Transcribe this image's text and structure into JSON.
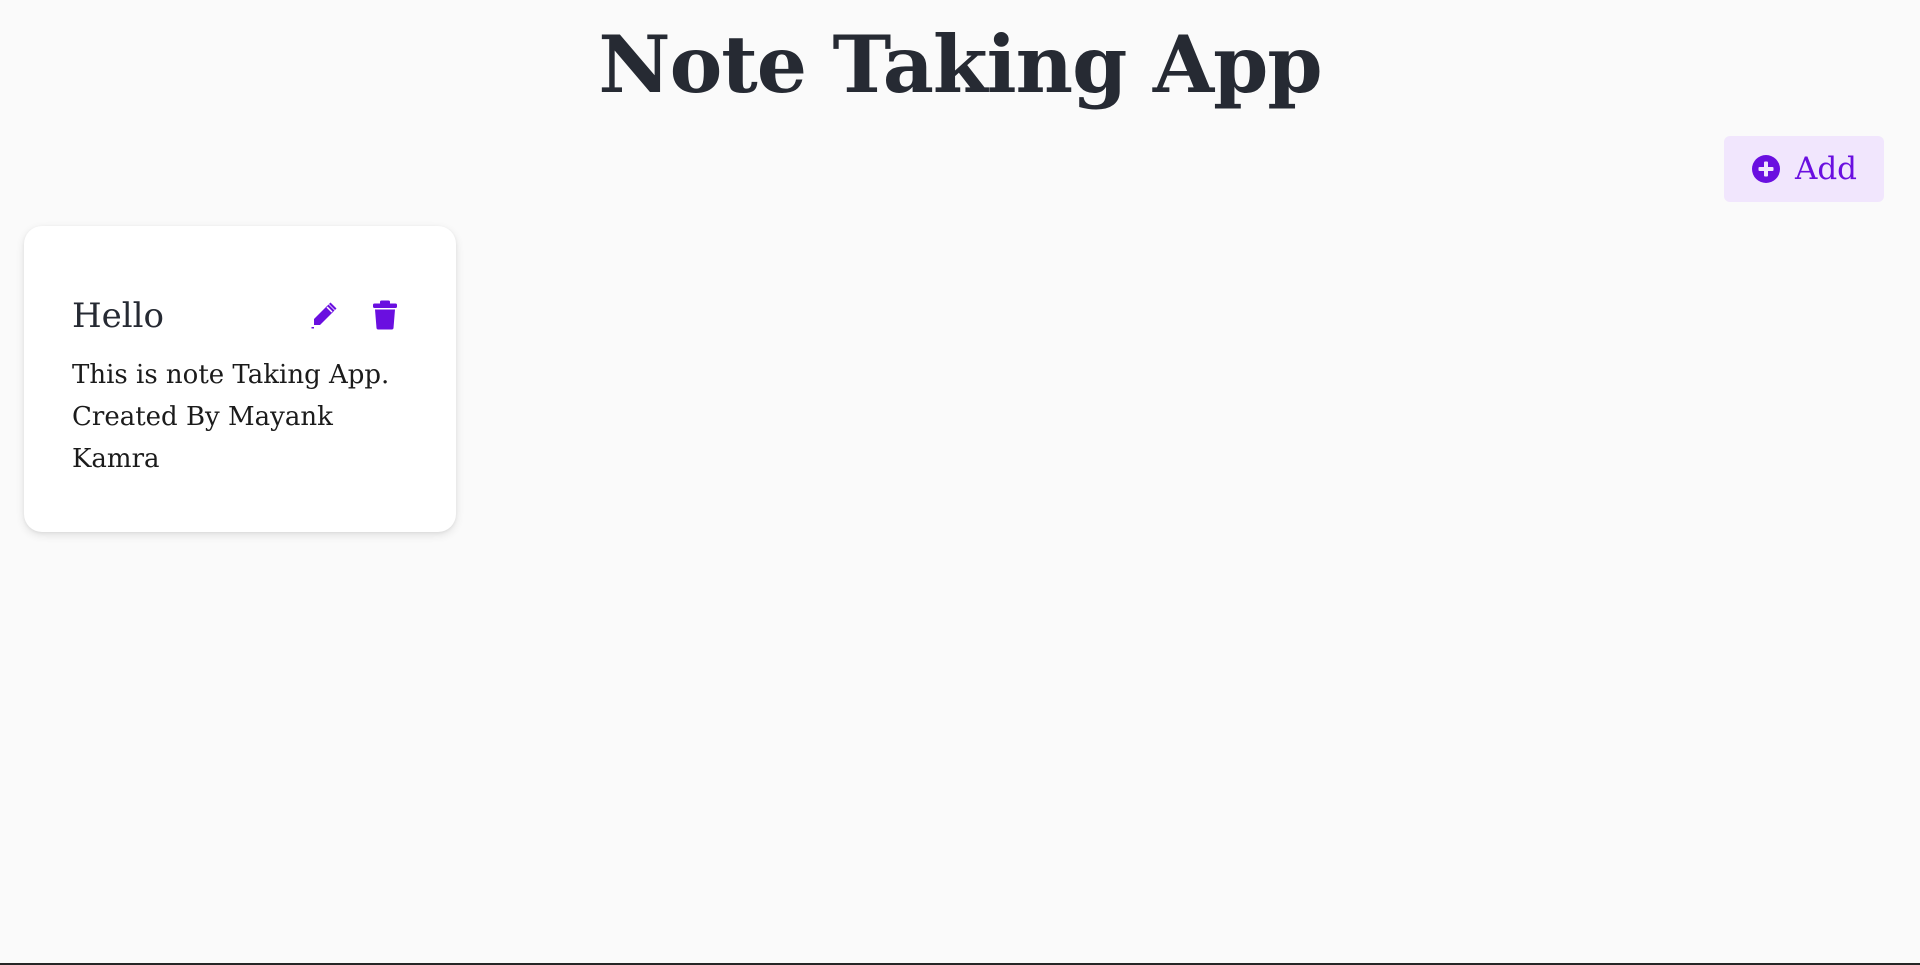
{
  "header": {
    "title": "Note Taking App"
  },
  "toolbar": {
    "add_label": "Add",
    "add_icon": "plus-circle-icon"
  },
  "notes": [
    {
      "title": "Hello",
      "body": "This is note Taking App. Created By Mayank Kamra",
      "edit_icon": "pencil-icon",
      "delete_icon": "trash-icon"
    }
  ],
  "colors": {
    "accent": "#6a0fe0",
    "add_button_bg": "#f1e6fd",
    "page_bg": "#fafafa",
    "title_text": "#262a33",
    "card_bg": "#ffffff"
  }
}
